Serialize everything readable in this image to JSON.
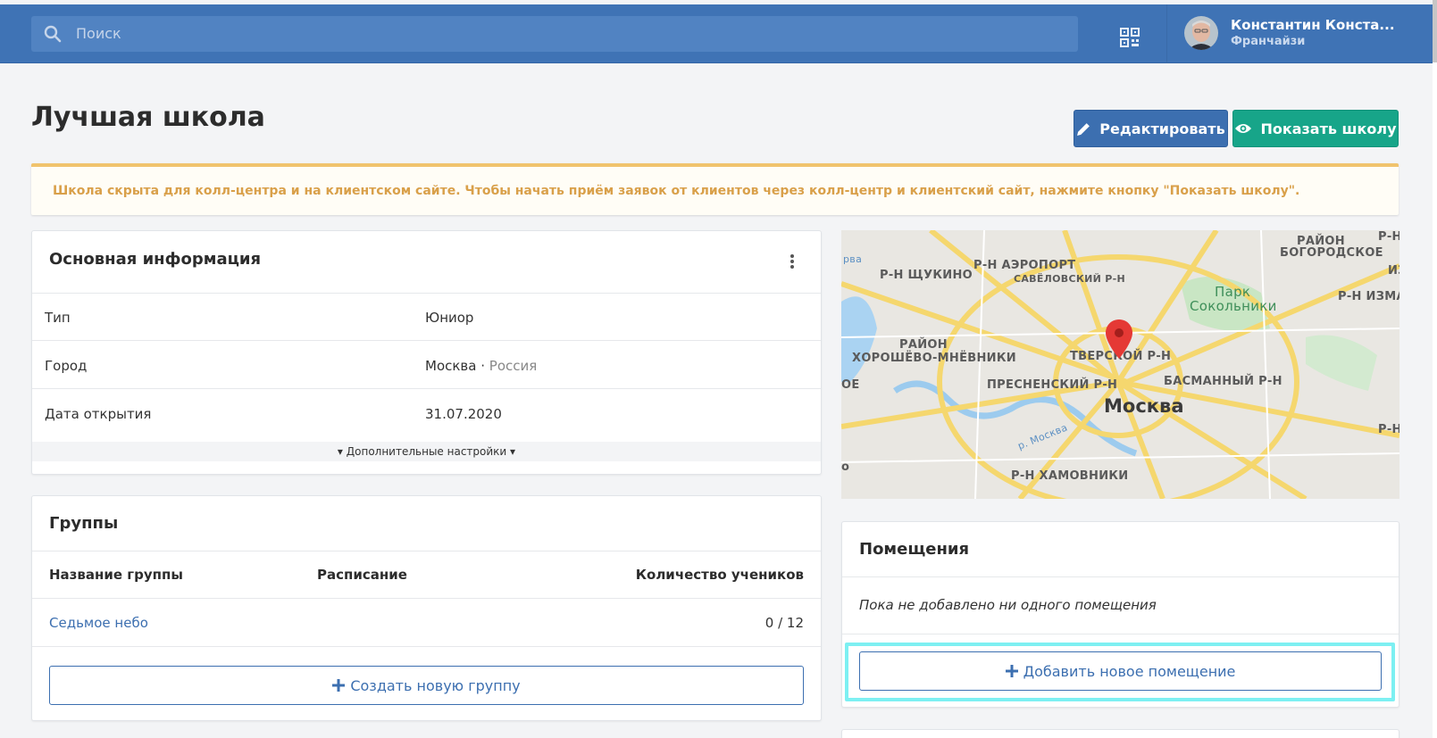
{
  "header": {
    "search_placeholder": "Поиск",
    "user_name": "Константин Конста...",
    "user_role": "Франчайзи"
  },
  "page": {
    "title": "Лучшая школа",
    "edit_button": "Редактировать",
    "show_button": "Показать школу",
    "alert": "Школа скрыта для колл-центра и на клиентском сайте. Чтобы начать приём заявок от клиентов через колл-центр и клиентский сайт, нажмите кнопку \"Показать школу\"."
  },
  "info": {
    "title": "Основная информация",
    "rows": [
      {
        "label": "Тип",
        "value": "Юниор"
      },
      {
        "label": "Город",
        "value": "Москва",
        "extra": "Россия"
      },
      {
        "label": "Дата открытия",
        "value": "31.07.2020"
      }
    ],
    "more": "Дополнительные настройки"
  },
  "groups": {
    "title": "Группы",
    "col_name": "Название группы",
    "col_schedule": "Расписание",
    "col_count": "Количество учеников",
    "rows": [
      {
        "name": "Седьмое небо",
        "schedule": "",
        "count": "0 / 12"
      }
    ],
    "create_button": "Создать новую группу"
  },
  "map": {
    "labels": [
      "РАЙОН",
      "БОГОРОДСКОЕ",
      "Р-Н",
      "Р-Н АЭРОПОРТ",
      "САВЁЛОВСКИЙ Р-Н",
      "Р-Н ЩУКИНО",
      "Парк",
      "Сокольники",
      "Р-Н ИЗМАЙ",
      "ИЗ",
      "РАЙОН",
      "ХОРОШЁВО-МНЁВНИКИ",
      "ТВЕРСКОЙ Р-Н",
      "БАСМАННЫЙ Р-Н",
      "ПРЕСНЕНСКИЙ Р-Н",
      "Москва",
      "Р-Н ХАМОВНИКИ",
      "Р-Н",
      "р. Москва",
      "рва",
      "ОЕ",
      "о"
    ]
  },
  "rooms": {
    "title": "Помещения",
    "empty": "Пока не добавлено ни одного помещения",
    "add_button": "Добавить новое помещение"
  }
}
